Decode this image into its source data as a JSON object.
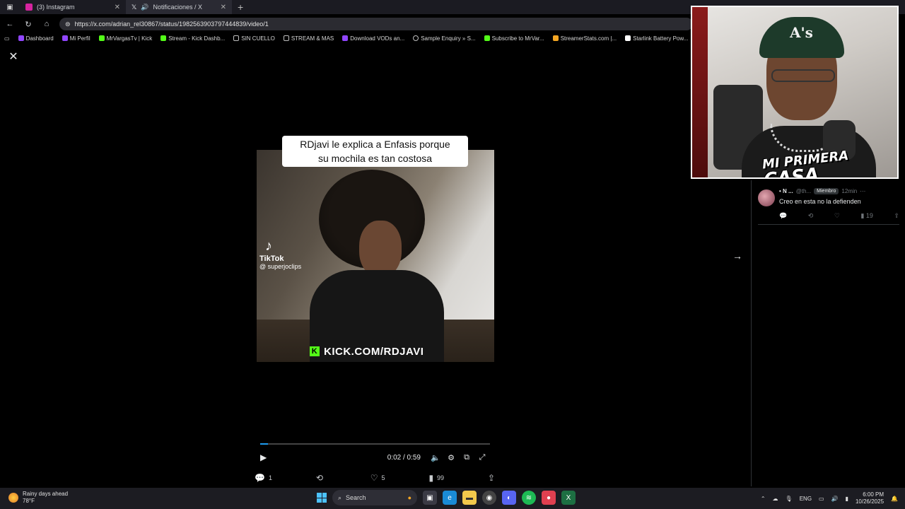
{
  "browser": {
    "tabs": [
      {
        "label": "(3) Instagram",
        "active": false,
        "favicon_color": "#d6249f"
      },
      {
        "label": "Notificaciones / X",
        "active": true,
        "favicon_color": "#ffffff"
      }
    ],
    "url": "https://x.com/adrian_rel30867/status/1982563903797444839/video/1",
    "bookmarks": [
      {
        "label": "Dashboard",
        "icon_color": "#9146ff"
      },
      {
        "label": "Mi Perfil",
        "icon_color": "#9146ff"
      },
      {
        "label": "MrVargasTv | Kick",
        "icon_color": "#53fc18"
      },
      {
        "label": "Stream - Kick Dashb...",
        "icon_color": "#53fc18"
      },
      {
        "label": "SIN CUELLO",
        "icon_color": "#bfbfbf"
      },
      {
        "label": "STREAM & MAS",
        "icon_color": "#bfbfbf"
      },
      {
        "label": "Download VODs an...",
        "icon_color": "#9146ff"
      },
      {
        "label": "Sample Enquiry » S...",
        "icon_color": "#bfbfbf"
      },
      {
        "label": "Subscribe to MrVar...",
        "icon_color": "#53fc18"
      },
      {
        "label": "StreamerStats.com |...",
        "icon_color": "#f5a623"
      },
      {
        "label": "Starlink Battery Pow...",
        "icon_color": "#ffffff"
      }
    ]
  },
  "video": {
    "caption_line1": "RDjavi le explica a Enfasis porque",
    "caption_line2": "su mochila es tan costosa",
    "tiktok_label": "TikTok",
    "tiktok_handle": "@ superjoclips",
    "kick_label": "KICK.COM/RDJAVI",
    "time": "0:02 / 0:59",
    "progress": 0.034
  },
  "post_actions": {
    "replies": "1",
    "reposts": "",
    "likes": "5",
    "views": "99"
  },
  "reply": {
    "name": "• N ...",
    "handle": "@th...",
    "badge": "Miembro",
    "time": "12min",
    "text": "Creo  en esta no la defienden",
    "views": "19"
  },
  "webcam": {
    "cap_logo": "A's",
    "title_line1": "MI PRIMERA",
    "title_line2": "CASA"
  },
  "taskbar": {
    "weather_title": "Rainy days ahead",
    "weather_temp": "78°F",
    "search_placeholder": "Search",
    "lang": "ENG",
    "time": "6:00 PM",
    "date": "10/26/2025"
  },
  "colors": {
    "accent": "#1d9bf0",
    "kick_green": "#53fc18"
  }
}
